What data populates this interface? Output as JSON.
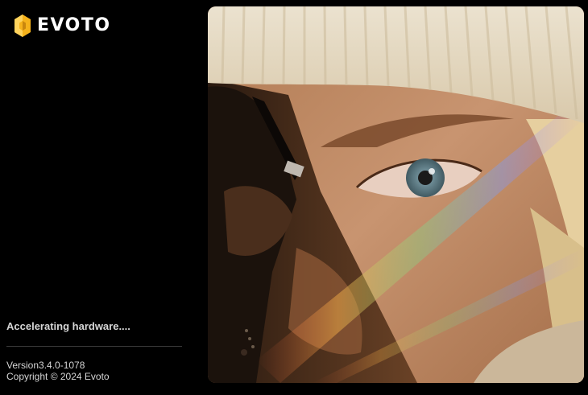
{
  "brand": {
    "name": "EVOTO",
    "logo_icon": "evoto-logo-icon",
    "accent_color": "#f5b21b"
  },
  "status": {
    "message": "Accelerating hardware...."
  },
  "footer": {
    "version": "Version3.4.0-1078",
    "copyright": "Copyright © 2024 Evoto"
  },
  "hero": {
    "image": "portrait-photo"
  }
}
